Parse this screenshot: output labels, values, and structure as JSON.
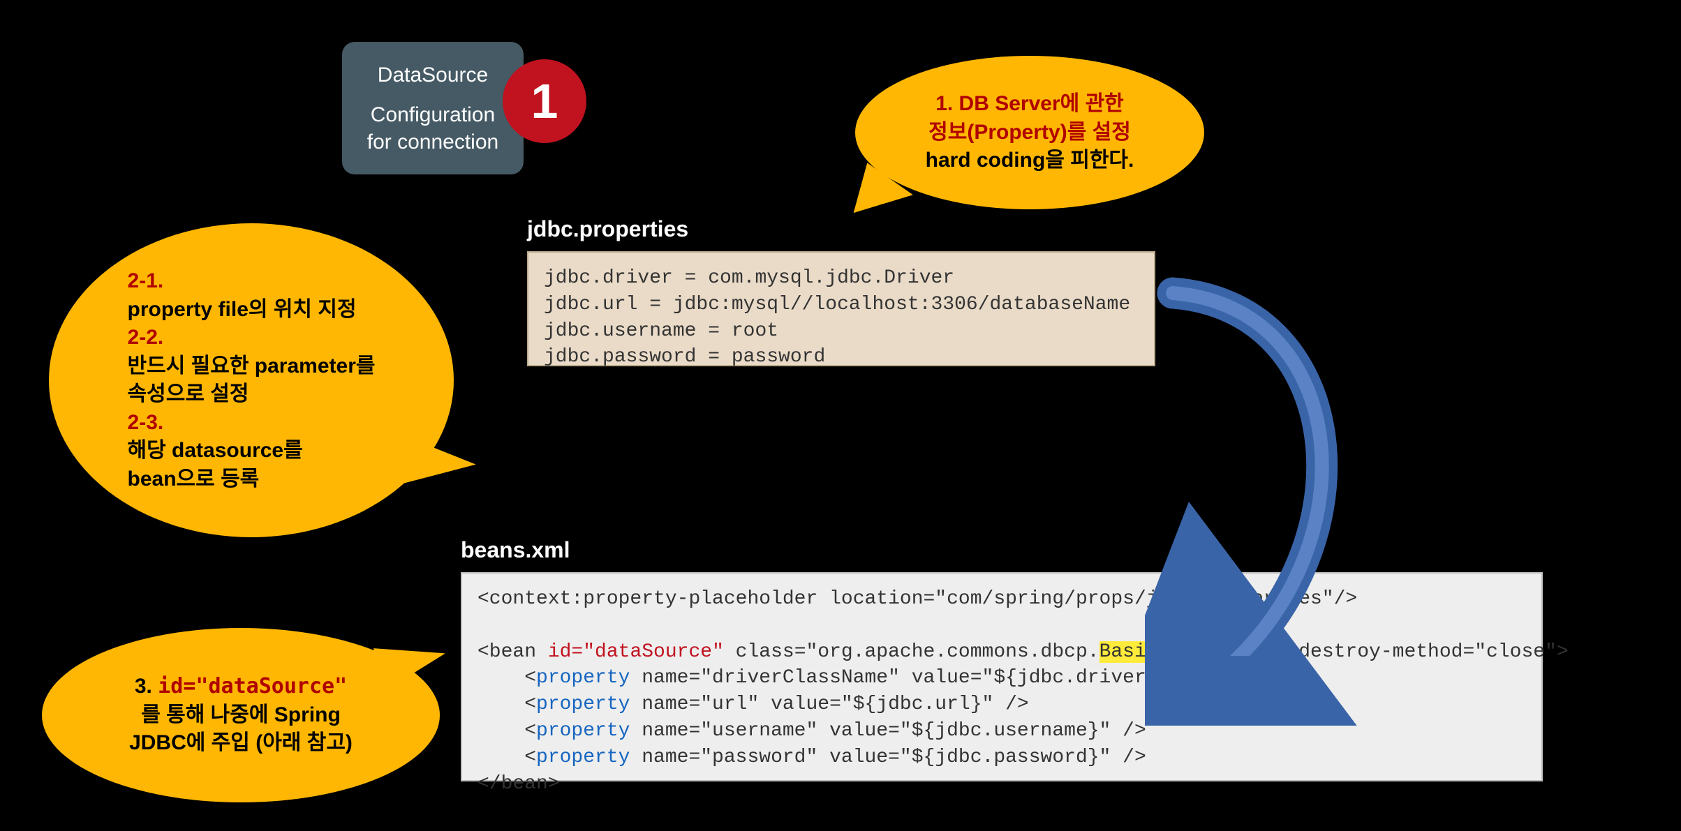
{
  "dsBox": {
    "title": "DataSource",
    "line1": "Configuration",
    "line2": "for connection"
  },
  "badge1": "1",
  "calloutTop": {
    "line1": "1. DB Server에 관한",
    "line2": "정보(Property)를 설정",
    "line3": "hard coding을 피한다."
  },
  "calloutLeft": {
    "h1": "2-1.",
    "l1": "property file의 위치 지정",
    "h2": "2-2.",
    "l2a": "반드시 필요한 parameter를",
    "l2b": "속성으로 설정",
    "h3": "2-3.",
    "l3a": "해당 datasource를",
    "l3b": "bean으로 등록"
  },
  "calloutBottom": {
    "prefix": "3. ",
    "redCode": "id=\"dataSource\"",
    "line2": "를 통해 나중에 Spring",
    "line3": "JDBC에 주입 (아래 참고)"
  },
  "label_props": "jdbc.properties",
  "label_beans": "beans.xml",
  "props": {
    "l1": "jdbc.driver = com.mysql.jdbc.Driver",
    "l2": "jdbc.url = jdbc:mysql//localhost:3306/databaseName",
    "l3": "jdbc.username = root",
    "l4": "jdbc.password = password"
  },
  "beans": {
    "l1": "<context:property-placeholder location=\"com/spring/props/jdbc.properties\"/>",
    "blank": "",
    "l2a": "<bean ",
    "l2b_red": "id=\"dataSource\"",
    "l2c": " class=\"org.apache.commons.dbcp.",
    "l2d_hi": "BasicDataSource",
    "l2e": "\" destroy-method=\"close\">",
    "l3a": "    <",
    "l_prop": "property",
    "l3b": " name=\"driverClassName\" value=\"${jdbc.driver}\" />",
    "l4b": " name=\"url\" value=\"${jdbc.url}\" />",
    "l5b": " name=\"username\" value=\"${jdbc.username}\" />",
    "l6b": " name=\"password\" value=\"${jdbc.password}\" />",
    "l7": "</bean>"
  }
}
